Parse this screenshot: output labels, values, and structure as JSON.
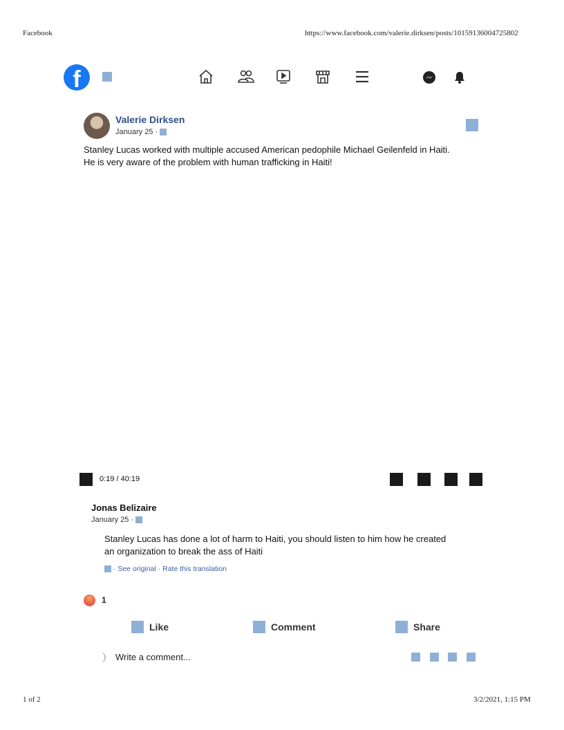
{
  "print_header": {
    "title": "Facebook",
    "url": "https://www.facebook.com/valerie.dirksen/posts/10159136004725802"
  },
  "nav": {
    "icons": [
      "facebook-logo",
      "home-icon",
      "friends-icon",
      "watch-icon",
      "marketplace-icon",
      "menu-icon",
      "messenger-icon",
      "notifications-icon"
    ]
  },
  "post": {
    "author": "Valerie Dirksen",
    "date": "January 25 ·",
    "text_line1": "Stanley Lucas worked with multiple accused American pedophile Michael Geilenfeld in Haiti.",
    "text_line2": "He is very aware of the problem with human trafficking in Haiti!"
  },
  "video": {
    "time": "0:19 / 40:19"
  },
  "comment": {
    "author": "Jonas Belizaire",
    "date": "January 25 ·",
    "text_line1": "Stanley Lucas has done a lot of harm to Haiti, you should listen to him how he created",
    "text_line2": "an organization to break the ass of Haiti",
    "translation": "· See original · Rate this translation"
  },
  "reactions": {
    "count": "1"
  },
  "actions": {
    "like": "Like",
    "comment": "Comment",
    "share": "Share"
  },
  "composer": {
    "placeholder": "Write a comment..."
  },
  "print_footer": {
    "page": "1 of 2",
    "datetime": "3/2/2021, 1:15 PM"
  }
}
